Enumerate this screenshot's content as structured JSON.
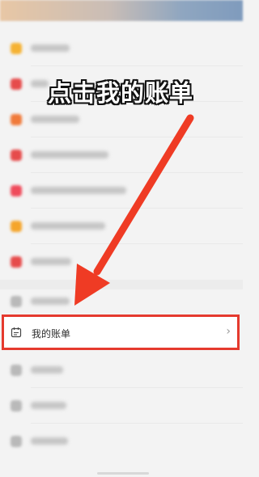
{
  "overlay": {
    "caption": "点击我的账单"
  },
  "menu": {
    "highlighted_item": {
      "label": "我的账单",
      "icon": "calendar-bill-icon",
      "chevron": "›"
    },
    "blurred_items": [
      {
        "icon_color": "#f5b233"
      },
      {
        "icon_color": "#e64b4b"
      },
      {
        "icon_color": "#f07a3a"
      },
      {
        "icon_color": "#e64b4b"
      },
      {
        "icon_color": "#ef4b5b"
      },
      {
        "icon_color": "#f5a52b"
      },
      {
        "icon_color": "#e64b4b"
      },
      {
        "icon_color": "#b9b9b9"
      },
      {
        "icon_color": "#b9b9b9"
      },
      {
        "icon_color": "#b9b9b9"
      },
      {
        "icon_color": "#b9b9b9"
      },
      {
        "icon_color": "#b9b9b9"
      }
    ]
  },
  "colors": {
    "highlight_border": "#e53a2e",
    "arrow": "#ef3b24"
  }
}
